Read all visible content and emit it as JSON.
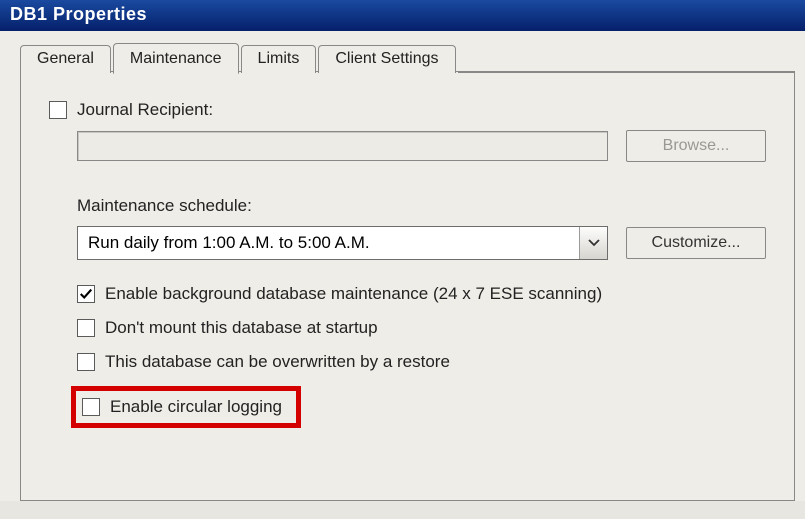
{
  "title": "DB1 Properties",
  "tabs": {
    "general": "General",
    "maintenance": "Maintenance",
    "limits": "Limits",
    "client_settings": "Client Settings",
    "active": "maintenance"
  },
  "maintenance": {
    "journal_recipient": {
      "checked": false,
      "label": "Journal Recipient:",
      "value": "",
      "browse_label": "Browse...",
      "browse_enabled": false
    },
    "schedule": {
      "label": "Maintenance schedule:",
      "selected": "Run daily from 1:00 A.M. to 5:00 A.M.",
      "customize_label": "Customize..."
    },
    "options": {
      "bg_maintenance": {
        "checked": true,
        "label": "Enable background database maintenance (24 x 7 ESE scanning)"
      },
      "dont_mount": {
        "checked": false,
        "label": "Don't mount this database at startup"
      },
      "overwrite": {
        "checked": false,
        "label": "This database can be overwritten by a restore"
      },
      "circular_log": {
        "checked": false,
        "label": "Enable circular logging"
      }
    }
  }
}
